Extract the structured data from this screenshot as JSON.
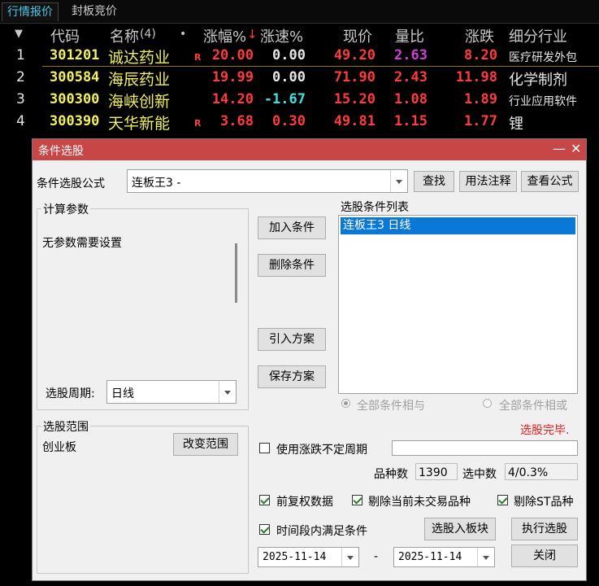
{
  "tabs": [
    "行情报价",
    "封板竞价"
  ],
  "table": {
    "sort_icon": "▼",
    "headers": [
      "代码",
      "名称",
      "(4)",
      "•",
      "涨幅%",
      "↓",
      "涨速%",
      "现价",
      "量比",
      "涨跌",
      "细分行业"
    ],
    "rows": [
      {
        "idx": "1",
        "code": "301201",
        "name": "诚达药业",
        "flag": "R",
        "chg_pct": "20.00",
        "speed": "0.00",
        "price": "49.20",
        "vol_ratio": "2.63",
        "change": "8.20",
        "industry": "医疗研发外包"
      },
      {
        "idx": "2",
        "code": "300584",
        "name": "海辰药业",
        "flag": "",
        "chg_pct": "19.99",
        "speed": "0.00",
        "price": "71.90",
        "vol_ratio": "2.43",
        "change": "11.98",
        "industry": "化学制剂"
      },
      {
        "idx": "3",
        "code": "300300",
        "name": "海峡创新",
        "flag": "",
        "chg_pct": "14.20",
        "speed": "-1.67",
        "price": "15.20",
        "vol_ratio": "1.08",
        "change": "1.89",
        "industry": "行业应用软件"
      },
      {
        "idx": "4",
        "code": "300390",
        "name": "天华新能",
        "flag": "R",
        "chg_pct": "3.68",
        "speed": "0.30",
        "price": "49.81",
        "vol_ratio": "1.15",
        "change": "1.77",
        "industry": "锂"
      }
    ]
  },
  "dialog": {
    "title": "条件选股",
    "minimize": "—",
    "close": "✕",
    "formula_label": "条件选股公式",
    "formula_value": "连板王3  -",
    "find_btn": "查找",
    "usage_btn": "用法注释",
    "view_btn": "查看公式",
    "params_title": "计算参数",
    "params_text": "无参数需要设置",
    "period_label": "选股周期:",
    "period_value": "日线",
    "add_btn": "加入条件",
    "delete_btn": "删除条件",
    "import_btn": "引入方案",
    "save_btn": "保存方案",
    "cond_list_title": "选股条件列表",
    "cond_items": [
      "连板王3  日线"
    ],
    "radio_and": "全部条件相与",
    "radio_or": "全部条件相或",
    "status": "选股完毕.",
    "range_title": "选股范围",
    "range_value": "创业板",
    "change_range_btn": "改变范围",
    "use_period_label": "使用涨跌不定周期",
    "count_label": "品种数",
    "count_value": "1390",
    "selected_label": "选中数",
    "selected_value": "4/0.3%",
    "chk_prior": "前复权数据",
    "chk_exclude_notrade": "剔除当前未交易品种",
    "chk_exclude_st": "剔除ST品种",
    "chk_timerange": "时间段内满足条件",
    "to_block_btn": "选股入板块",
    "execute_btn": "执行选股",
    "close_btn": "关闭",
    "date_from": "2025-11-14",
    "date_sep": "-",
    "date_to": "2025-11-14"
  }
}
